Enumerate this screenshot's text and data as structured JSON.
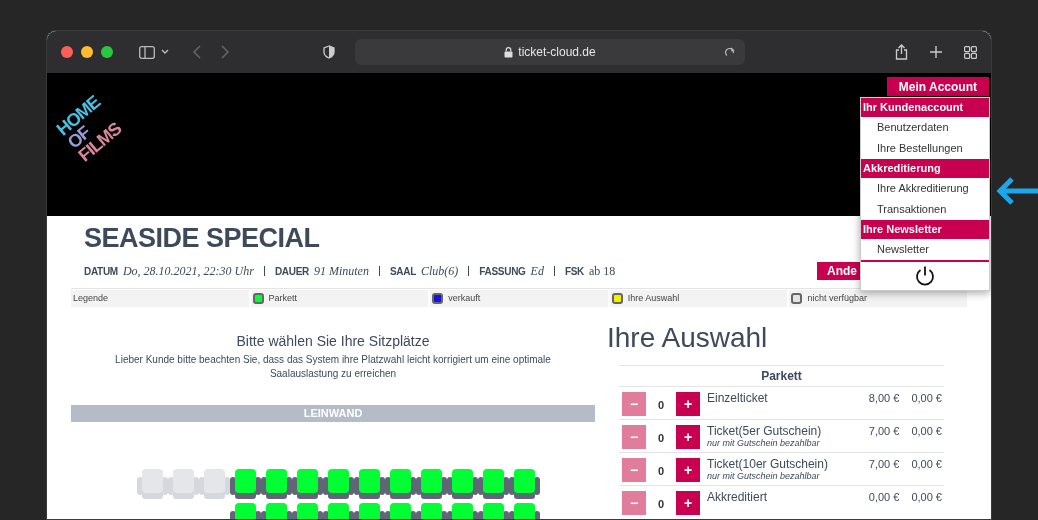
{
  "browser": {
    "url": "ticket-cloud.de"
  },
  "logo": {
    "lines": [
      "HOME",
      "OF",
      "FILMS"
    ]
  },
  "account_menu": {
    "button": "Mein Account",
    "sections": [
      {
        "title": "Ihr Kundenaccount",
        "items": [
          "Benutzerdaten",
          "Ihre Bestellungen"
        ]
      },
      {
        "title": "Akkreditierung",
        "items": [
          "Ihre Akkreditierung",
          "Transaktionen"
        ]
      },
      {
        "title": "Ihre Newsletter",
        "items": [
          "Newsletter"
        ]
      }
    ]
  },
  "event": {
    "title": "SEASIDE SPECIAL",
    "details": [
      {
        "label": "DATUM",
        "value": "Do, 28.10.2021, 22:30 Uhr",
        "italic": true
      },
      {
        "label": "DAUER",
        "value": "91 Minuten",
        "italic": true
      },
      {
        "label": "SAAL",
        "value": "Club(6)",
        "italic": true
      },
      {
        "label": "FASSUNG",
        "value": "Ed",
        "italic": true
      },
      {
        "label": "FSK",
        "value": "ab 18",
        "italic": false
      }
    ],
    "change_button": "Ande"
  },
  "legend": {
    "title": "Legende",
    "items": [
      {
        "label": "Parkett",
        "color": "#00ff33"
      },
      {
        "label": "verkauft",
        "color": "#1414d6"
      },
      {
        "label": "Ihre Auswahl",
        "color": "#f2f200"
      },
      {
        "label": "nicht verfügbar",
        "color": "#e2e4e7"
      }
    ]
  },
  "seating": {
    "heading": "Bitte wählen Sie Ihre Sitzplätze",
    "note": "Lieber Kunde bitte beachten Sie, dass das System ihre Platzwahl leicht korrigiert um eine optimale Saalauslastung zu erreichen",
    "screen_label": "LEINWAND",
    "rows": [
      {
        "seats": [
          {
            "kind": "unavailable"
          },
          {
            "kind": "unavailable"
          },
          {
            "kind": "unavailable"
          },
          {
            "kind": "available"
          },
          {
            "kind": "available"
          },
          {
            "kind": "available"
          },
          {
            "kind": "available"
          },
          {
            "kind": "available"
          },
          {
            "kind": "available"
          },
          {
            "kind": "available"
          },
          {
            "kind": "available"
          },
          {
            "kind": "available"
          },
          {
            "kind": "available"
          }
        ]
      },
      {
        "seats": [
          {
            "kind": "available"
          },
          {
            "kind": "available"
          },
          {
            "kind": "available"
          },
          {
            "kind": "available"
          },
          {
            "kind": "available"
          },
          {
            "kind": "available"
          },
          {
            "kind": "available"
          },
          {
            "kind": "available"
          },
          {
            "kind": "available"
          },
          {
            "kind": "available"
          }
        ]
      }
    ]
  },
  "selection": {
    "heading": "Ihre Auswahl",
    "category": "Parkett",
    "tickets": [
      {
        "minus": "−",
        "count": "0",
        "plus": "+",
        "name": "Einzelticket",
        "price": "8,00 €",
        "total": "0,00 €",
        "decrement_enabled": false
      },
      {
        "minus": "−",
        "count": "0",
        "plus": "+",
        "name": "Ticket(5er Gutschein)",
        "note": "nur mit Gutschein bezahlbar",
        "price": "7,00 €",
        "total": "0,00 €",
        "decrement_enabled": false
      },
      {
        "minus": "−",
        "count": "0",
        "plus": "+",
        "name": "Ticket(10er Gutschein)",
        "note": "nur mit Gutschein bezahlbar",
        "price": "7,00 €",
        "total": "0,00 €",
        "decrement_enabled": false
      },
      {
        "minus": "−",
        "count": "0",
        "plus": "+",
        "name": "Akkreditiert",
        "price": "0,00 €",
        "total": "0,00 €",
        "decrement_enabled": false
      }
    ]
  }
}
